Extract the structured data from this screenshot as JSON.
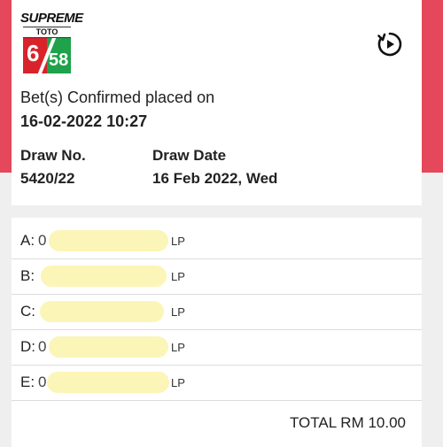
{
  "logo": {
    "brand": "SUPREME",
    "sub": "TOTO",
    "game_left": "6",
    "game_right": "58"
  },
  "header": {
    "replay_icon": "replay-icon"
  },
  "confirmation": {
    "label": "Bet(s) Confirmed placed on",
    "datetime": "16-02-2022 10:27"
  },
  "draw": {
    "no_label": "Draw No.",
    "no_value": "5420/22",
    "date_label": "Draw Date",
    "date_value": "16 Feb 2022, Wed"
  },
  "bets": [
    {
      "label": "A:",
      "number": "0",
      "unit": "LP"
    },
    {
      "label": "B:",
      "number": "",
      "unit": "LP"
    },
    {
      "label": "C:",
      "number": "",
      "unit": "LP"
    },
    {
      "label": "D:",
      "number": "0",
      "unit": "LP"
    },
    {
      "label": "E:",
      "number": "0",
      "unit": "LP"
    }
  ],
  "total": {
    "text": "TOTAL RM 10.00"
  },
  "colors": {
    "background": "#e5485a",
    "panel": "#efefef",
    "mask": "#fbf5b8"
  }
}
